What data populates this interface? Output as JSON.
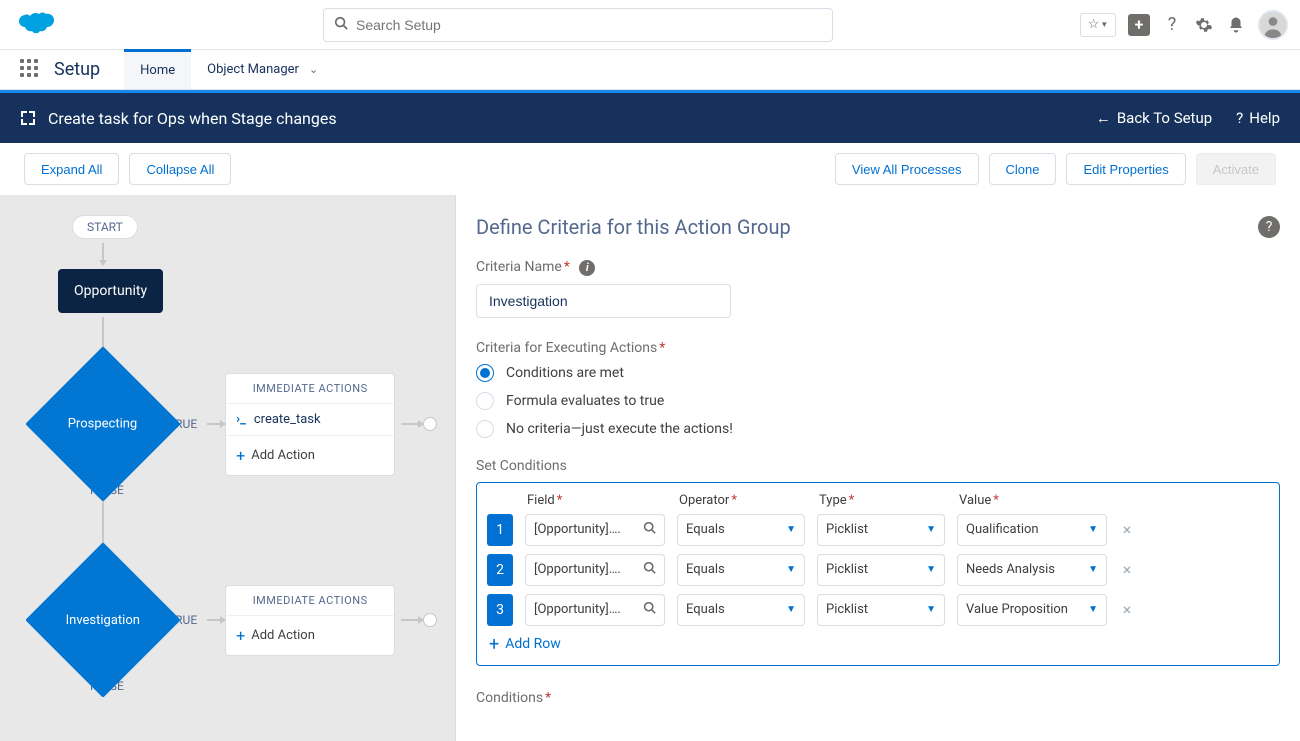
{
  "header": {
    "search_placeholder": "Search Setup"
  },
  "context": {
    "app_name": "Setup",
    "tabs": {
      "home": "Home",
      "object_manager": "Object Manager"
    }
  },
  "bluebar": {
    "title": "Create task for Ops when Stage changes",
    "back": "Back To Setup",
    "help": "Help"
  },
  "toolbar": {
    "expand": "Expand All",
    "collapse": "Collapse All",
    "view_all": "View All Processes",
    "clone": "Clone",
    "edit_props": "Edit Properties",
    "activate": "Activate"
  },
  "flow": {
    "start": "START",
    "object": "Opportunity",
    "true_label": "TRUE",
    "false_label": "FALSE",
    "immediate_actions": "IMMEDIATE ACTIONS",
    "add_action": "Add Action",
    "criteria1": "Prospecting",
    "criteria2": "Investigation",
    "action1": "create_task"
  },
  "panel": {
    "title": "Define Criteria for this Action Group",
    "criteria_name_label": "Criteria Name",
    "criteria_name_value": "Investigation",
    "exec_label": "Criteria for Executing Actions",
    "radio1": "Conditions are met",
    "radio2": "Formula evaluates to true",
    "radio3": "No criteria—just execute the actions!",
    "set_conditions": "Set Conditions",
    "col_field": "Field",
    "col_operator": "Operator",
    "col_type": "Type",
    "col_value": "Value",
    "add_row": "Add Row",
    "conditions_label": "Conditions",
    "rows": [
      {
        "n": "1",
        "field": "[Opportunity]….",
        "op": "Equals",
        "type": "Picklist",
        "val": "Qualification"
      },
      {
        "n": "2",
        "field": "[Opportunity]….",
        "op": "Equals",
        "type": "Picklist",
        "val": "Needs Analysis"
      },
      {
        "n": "3",
        "field": "[Opportunity]….",
        "op": "Equals",
        "type": "Picklist",
        "val": "Value Proposition"
      }
    ]
  }
}
